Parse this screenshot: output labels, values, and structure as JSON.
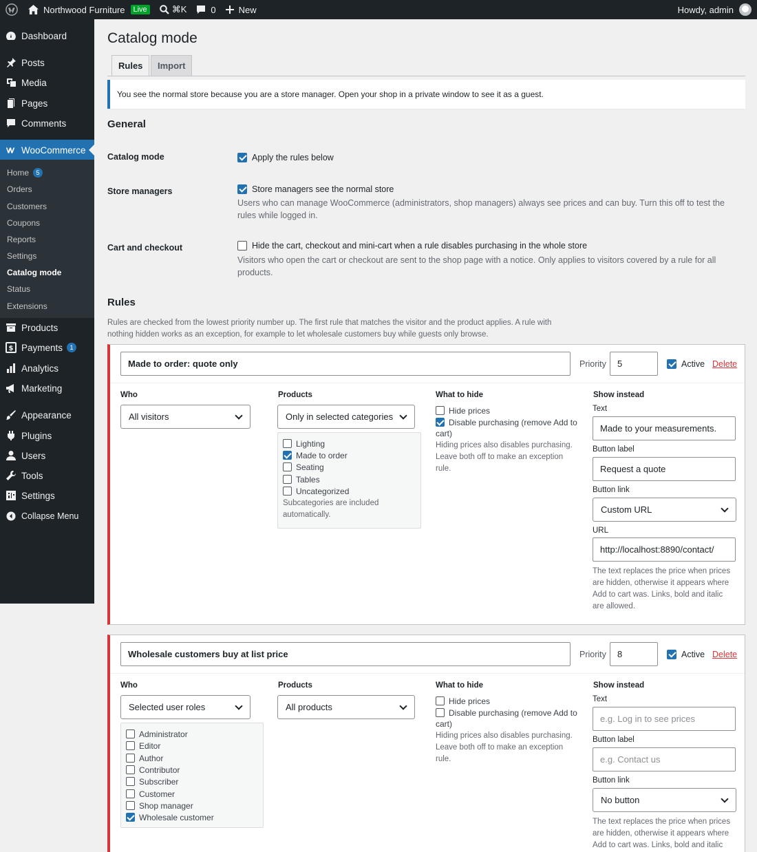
{
  "adminbar": {
    "site_name": "Northwood Furniture",
    "live_badge": "Live",
    "search_shortcut": "⌘K",
    "comments_count": "0",
    "new_label": "New",
    "howdy": "Howdy, admin"
  },
  "sidebar": {
    "dashboard": "Dashboard",
    "posts": "Posts",
    "media": "Media",
    "pages": "Pages",
    "comments": "Comments",
    "woocommerce": "WooCommerce",
    "sub": {
      "home": "Home",
      "home_badge": "5",
      "orders": "Orders",
      "customers": "Customers",
      "coupons": "Coupons",
      "reports": "Reports",
      "settings": "Settings",
      "catalog_mode": "Catalog mode",
      "status": "Status",
      "extensions": "Extensions"
    },
    "products": "Products",
    "payments": "Payments",
    "payments_badge": "1",
    "analytics": "Analytics",
    "marketing": "Marketing",
    "appearance": "Appearance",
    "plugins": "Plugins",
    "users": "Users",
    "tools": "Tools",
    "settings": "Settings",
    "collapse": "Collapse Menu"
  },
  "page": {
    "title": "Catalog mode",
    "tabs": [
      "Rules",
      "Import"
    ],
    "notice": "You see the normal store because you are a store manager. Open your shop in a private window to see it as a guest."
  },
  "general": {
    "heading": "General",
    "catalog_mode": {
      "label": "Catalog mode",
      "checkbox": "Apply the rules below",
      "checked": true
    },
    "store_managers": {
      "label": "Store managers",
      "checkbox": "Store managers see the normal store",
      "checked": true,
      "desc_1": "Users who can manage WooCommerce (administrators, shop managers) always see prices and can buy. Turn this off to test the",
      "desc_2": "rules while logged in."
    },
    "cart_checkout": {
      "label": "Cart and checkout",
      "checkbox": "Hide the cart, checkout and mini-cart when a rule disables purchasing in the whole store",
      "checked": false,
      "desc_1": "Visitors who open the cart or checkout are sent to the shop page with a notice. Only applies to visitors covered by a rule for all",
      "desc_2": "products."
    }
  },
  "rules_section": {
    "heading": "Rules",
    "desc_1": "Rules are checked from the lowest priority number up. The first rule that matches the visitor and the product applies. A rule with",
    "desc_2": "nothing hidden works as an exception, for example to let wholesale customers buy while guests only browse."
  },
  "labels": {
    "priority": "Priority",
    "active": "Active",
    "delete": "Delete",
    "who": "Who",
    "products": "Products",
    "what_to_hide": "What to hide",
    "show_instead": "Show instead",
    "text": "Text",
    "button_label": "Button label",
    "button_link": "Button link",
    "url": "URL",
    "hide_prices": "Hide prices",
    "disable_purchasing_1": "Disable purchasing (remove Add to",
    "disable_purchasing_2": "cart)",
    "hide_help_1": "Hiding prices also disables purchasing.",
    "hide_help_2": "Leave both off to make an exception",
    "hide_help_3": "rule.",
    "show_help_1": "The text replaces the price when prices",
    "show_help_2": "are hidden, otherwise it appears where",
    "show_help_3": "Add to cart was. Links, bold and italic",
    "show_help_4": "are allowed.",
    "subcat_help_1": "Subcategories are included",
    "subcat_help_2": "automatically."
  },
  "rules": [
    {
      "name": "Made to order: quote only",
      "priority": "5",
      "active": true,
      "who": "All visitors",
      "products": "Only in selected categories",
      "categories": [
        {
          "label": "Lighting",
          "checked": false
        },
        {
          "label": "Made to order",
          "checked": true
        },
        {
          "label": "Seating",
          "checked": false
        },
        {
          "label": "Tables",
          "checked": false
        },
        {
          "label": "Uncategorized",
          "checked": false
        }
      ],
      "hide_prices": false,
      "disable_purchasing": true,
      "text": "Made to your measurements.",
      "button_label": "Request a quote",
      "button_link": "Custom URL",
      "url": "http://localhost:8890/contact/"
    },
    {
      "name": "Wholesale customers buy at list price",
      "priority": "8",
      "active": true,
      "who": "Selected user roles",
      "roles": [
        {
          "label": "Administrator",
          "checked": false
        },
        {
          "label": "Editor",
          "checked": false
        },
        {
          "label": "Author",
          "checked": false
        },
        {
          "label": "Contributor",
          "checked": false
        },
        {
          "label": "Subscriber",
          "checked": false
        },
        {
          "label": "Customer",
          "checked": false
        },
        {
          "label": "Shop manager",
          "checked": false
        },
        {
          "label": "Wholesale customer",
          "checked": true
        }
      ],
      "products": "All products",
      "hide_prices": false,
      "disable_purchasing": false,
      "text_placeholder": "e.g. Log in to see prices",
      "button_label_placeholder": "e.g. Contact us",
      "button_link": "No button"
    }
  ],
  "colors": {
    "accent": "#2271b1",
    "danger": "#d63638",
    "admin_bg": "#1d2327",
    "live": "#00a32a"
  }
}
